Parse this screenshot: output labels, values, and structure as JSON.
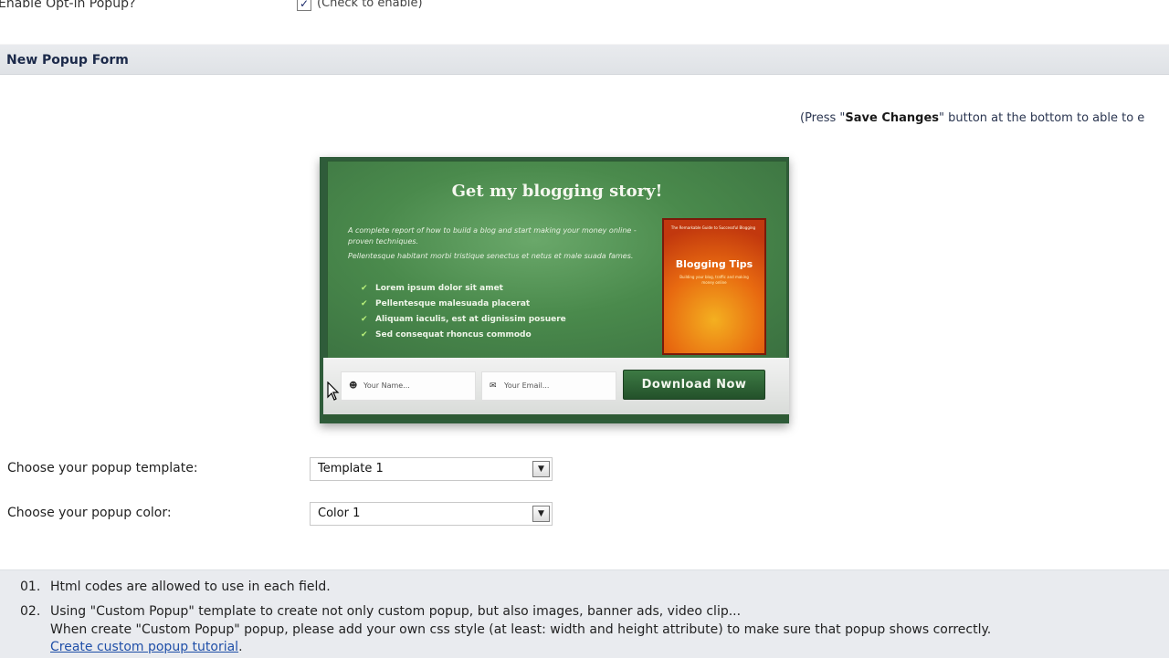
{
  "top": {
    "label": "Enable Opt-in Popup?",
    "check_mark": "✓",
    "hint": "(Check to enable)"
  },
  "section": {
    "title": "New Popup Form"
  },
  "press_note": {
    "before": "(Press \"",
    "bold": "Save Changes",
    "after": "\" button at the bottom to able to e"
  },
  "preview": {
    "title": "Get my blogging story!",
    "desc_1": "A complete report of how to build a blog and start making your money online - proven techniques.",
    "desc_2": "Pellentesque habitant morbi tristique senectus et netus et male suada fames.",
    "bullets": [
      "Lorem ipsum dolor sit amet",
      "Pellentesque malesuada placerat",
      "Aliquam iaculis, est at dignissim posuere",
      "Sed consequat rhoncus commodo"
    ],
    "book": {
      "top_text": "The Remarkable Guide to Successful Blogging",
      "title": "Blogging Tips",
      "subtitle": "Building your blog, traffic and making money online"
    },
    "name_placeholder": "Your Name...",
    "email_placeholder": "Your Email...",
    "button": "Download Now",
    "icons": {
      "user": "user-icon",
      "email": "envelope-icon",
      "check": "checkmark-icon"
    }
  },
  "form": {
    "template_label": "Choose your popup template:",
    "template_value": "Template 1",
    "color_label": "Choose your popup color:",
    "color_value": "Color 1"
  },
  "notes": {
    "n1_num": "01.",
    "n1_text": "Html codes are allowed to use in each field.",
    "n2_num": "02.",
    "n2_text": "Using \"Custom Popup\" template to create not only custom popup, but also images, banner ads, video clip...",
    "n2_line2": "When create \"Custom Popup\" popup, please add your own css style (at least: width and height attribute) to make sure that popup shows correctly.",
    "n2_link": "Create custom popup tutorial",
    "n2_link_end": "."
  }
}
